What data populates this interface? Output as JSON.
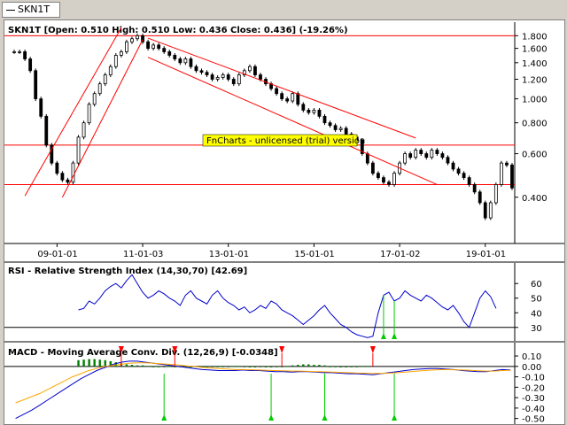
{
  "tab": {
    "label": "SKN1T"
  },
  "watermark": "FnCharts - unlicensed (trial) version",
  "colors": {
    "price_line": "#ff0000",
    "rsi": "#0000cc",
    "macd": "#0000cc",
    "signal": "#ffa500",
    "hist": "#008000",
    "buy": "#00cc00",
    "sell": "#ff0000",
    "watermark_bg": "#ffff00"
  },
  "panels": {
    "price": {
      "title": "SKN1T [Open: 0.510  High: 0.510  Low: 0.436  Close: 0.436]  (-19.26%)"
    },
    "rsi": {
      "title": "RSI - Relative Strength Index (14,30,70) [42.69]"
    },
    "macd": {
      "title": "MACD - Moving Average Conv. Div. (12,26,9) [-0.0348]"
    }
  },
  "chart_data": [
    {
      "type": "candlestick",
      "title": "SKN1T [Open: 0.510  High: 0.510  Low: 0.436  Close: 0.436]  (-19.26%)",
      "y_scale": "log",
      "ylim": [
        0.26,
        1.85
      ],
      "y_ticks": [
        1.8,
        1.6,
        1.4,
        1.2,
        1.0,
        0.8,
        0.6,
        0.4
      ],
      "x_ticks": [
        "09-01-01",
        "11-01-03",
        "13-01-01",
        "15-01-01",
        "17-01-02",
        "19-01-01"
      ],
      "x_tick_pos": [
        8,
        24,
        40,
        56,
        72,
        88
      ],
      "horizontal_lines": [
        1.8,
        0.65,
        0.45
      ],
      "close": [
        1.55,
        1.55,
        1.45,
        1.3,
        1.0,
        0.85,
        0.65,
        0.55,
        0.5,
        0.47,
        0.46,
        0.55,
        0.7,
        0.8,
        0.95,
        1.05,
        1.15,
        1.25,
        1.35,
        1.5,
        1.55,
        1.7,
        1.75,
        1.8,
        1.7,
        1.6,
        1.65,
        1.6,
        1.55,
        1.5,
        1.45,
        1.4,
        1.45,
        1.35,
        1.3,
        1.28,
        1.25,
        1.2,
        1.22,
        1.25,
        1.2,
        1.15,
        1.25,
        1.3,
        1.35,
        1.25,
        1.2,
        1.15,
        1.1,
        1.05,
        1.0,
        0.98,
        1.05,
        0.95,
        0.9,
        0.88,
        0.9,
        0.85,
        0.8,
        0.78,
        0.75,
        0.76,
        0.72,
        0.7,
        0.68,
        0.6,
        0.55,
        0.5,
        0.48,
        0.46,
        0.45,
        0.5,
        0.55,
        0.6,
        0.58,
        0.62,
        0.6,
        0.58,
        0.62,
        0.6,
        0.58,
        0.55,
        0.52,
        0.5,
        0.48,
        0.45,
        0.42,
        0.38,
        0.33,
        0.38,
        0.45,
        0.55,
        0.54,
        0.436
      ]
    },
    {
      "type": "line",
      "title": "RSI - Relative Strength Index (14,30,70) [42.69]",
      "ylim": [
        22,
        68
      ],
      "y_ticks": [
        60,
        50,
        40,
        30
      ],
      "reference_lines": [
        30
      ],
      "start_index": 12,
      "series": [
        {
          "values": [
            42,
            43,
            48,
            46,
            50,
            55,
            58,
            60,
            57,
            62,
            66,
            60,
            54,
            50,
            52,
            55,
            53,
            50,
            48,
            45,
            52,
            55,
            50,
            48,
            46,
            52,
            55,
            50,
            47,
            45,
            42,
            44,
            40,
            42,
            45,
            43,
            48,
            46,
            42,
            40,
            38,
            35,
            32,
            35,
            38,
            42,
            45,
            40,
            36,
            32,
            30,
            27,
            25,
            24,
            23,
            24,
            40,
            52,
            54,
            48,
            50,
            55,
            52,
            50,
            48,
            52,
            50,
            47,
            44,
            42,
            45,
            40,
            34,
            30,
            40,
            50,
            55,
            51,
            43
          ]
        }
      ]
    },
    {
      "type": "line",
      "title": "MACD - Moving Average Conv. Div. (12,26,9) [-0.0348]",
      "ylim": [
        -0.52,
        0.16
      ],
      "y_ticks": [
        0.1,
        0.0,
        -0.1,
        -0.2,
        -0.3,
        -0.4,
        -0.5
      ],
      "series": [
        {
          "values": [
            -0.5,
            -0.46,
            -0.42,
            -0.37,
            -0.32,
            -0.27,
            -0.22,
            -0.17,
            -0.12,
            -0.08,
            -0.04,
            -0.01,
            0.02,
            0.04,
            0.05,
            0.05,
            0.04,
            0.03,
            0.02,
            0.01,
            0.0,
            -0.01,
            -0.02,
            -0.03,
            -0.035,
            -0.04,
            -0.04,
            -0.04,
            -0.035,
            -0.04,
            -0.04,
            -0.045,
            -0.05,
            -0.05,
            -0.055,
            -0.05,
            -0.05,
            -0.055,
            -0.06,
            -0.06,
            -0.065,
            -0.07,
            -0.07,
            -0.075,
            -0.08,
            -0.07,
            -0.06,
            -0.05,
            -0.04,
            -0.03,
            -0.025,
            -0.02,
            -0.02,
            -0.025,
            -0.03,
            -0.04,
            -0.045,
            -0.05,
            -0.05,
            -0.04,
            -0.03,
            -0.035
          ]
        },
        {
          "values": [
            -0.35,
            -0.32,
            -0.29,
            -0.26,
            -0.22,
            -0.18,
            -0.14,
            -0.1,
            -0.07,
            -0.04,
            -0.02,
            0.0,
            0.01,
            0.02,
            0.03,
            0.035,
            0.035,
            0.03,
            0.025,
            0.02,
            0.015,
            0.005,
            0.0,
            -0.01,
            -0.015,
            -0.02,
            -0.025,
            -0.03,
            -0.03,
            -0.032,
            -0.035,
            -0.038,
            -0.04,
            -0.042,
            -0.045,
            -0.045,
            -0.047,
            -0.05,
            -0.052,
            -0.055,
            -0.058,
            -0.06,
            -0.063,
            -0.065,
            -0.068,
            -0.068,
            -0.065,
            -0.06,
            -0.055,
            -0.048,
            -0.042,
            -0.036,
            -0.032,
            -0.03,
            -0.032,
            -0.035,
            -0.038,
            -0.042,
            -0.045,
            -0.045,
            -0.04,
            -0.038
          ]
        }
      ],
      "hist_start_index": 12,
      "hist": [
        0.06,
        0.065,
        0.07,
        0.07,
        0.065,
        0.06,
        0.05,
        0.04,
        0.03,
        0.02,
        0.015,
        0.01,
        0.01,
        0.005,
        0.0,
        -0.005,
        0.0,
        0.005,
        0.0,
        -0.005,
        -0.01,
        -0.01,
        -0.005,
        0.0,
        0.0,
        -0.005,
        0.0,
        0.0,
        0.0,
        0.005,
        0.005,
        0.0,
        -0.01,
        -0.01,
        -0.005,
        -0.01,
        -0.01,
        -0.005,
        0.0,
        0.005,
        0.01,
        0.015,
        0.02,
        0.02,
        0.015,
        0.015,
        0.01,
        0.0,
        -0.005,
        -0.01,
        -0.01,
        -0.005,
        0.0,
        0.005,
        0.005
      ],
      "sell_signals": [
        20,
        30,
        50,
        67
      ],
      "buy_signals": [
        28,
        48,
        58,
        71
      ]
    }
  ]
}
